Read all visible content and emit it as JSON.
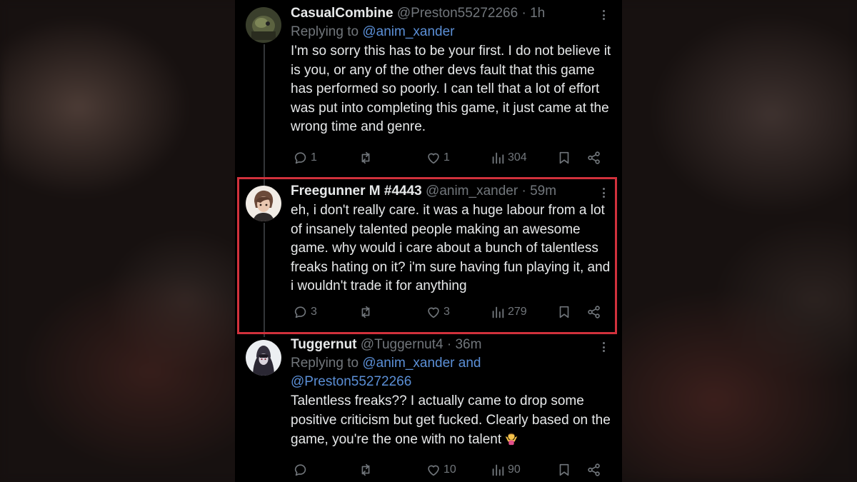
{
  "tweets": [
    {
      "name": "CasualCombine",
      "handle": "@Preston55272266",
      "sep": "·",
      "time": "1h",
      "reply_prefix": "Replying to",
      "reply_mentions": "@anim_xander",
      "reply_mentions_2": "",
      "body": "I'm so sorry this has to be your first. I do not believe it is you, or any of the other devs fault that this game has performed so poorly. I can tell that a lot of effort was put into completing this game, it just came at the wrong time and genre.",
      "replies": "1",
      "retweets": "",
      "likes": "1",
      "views": "304"
    },
    {
      "name": "Freegunner M #4443",
      "handle": "@anim_xander",
      "sep": "·",
      "time": "59m",
      "body": "eh, i don't really care. it was a huge labour from a lot of insanely talented people making an awesome game. why would i care about a bunch of talentless freaks hating on it? i'm sure having fun playing it, and i wouldn't trade it for anything",
      "replies": "3",
      "retweets": "",
      "likes": "3",
      "views": "279"
    },
    {
      "name": "Tuggernut",
      "handle": "@Tuggernut4",
      "sep": "·",
      "time": "36m",
      "reply_prefix": "Replying to",
      "reply_mentions": "@anim_xander and",
      "reply_mentions_2": "@Preston55272266",
      "body": "Talentless freaks?? I actually came to drop some positive criticism but get fucked. Clearly based on the game, you're the one with no talent",
      "replies": "",
      "retweets": "",
      "likes": "10",
      "views": "90"
    }
  ],
  "icons": {
    "reply": "reply-icon",
    "retweet": "retweet-icon",
    "like": "heart-icon",
    "views": "views-icon",
    "bookmark": "bookmark-icon",
    "share": "share-icon",
    "more": "more-icon",
    "emoji": "person-shrugging-emoji"
  },
  "colors": {
    "background": "#000000",
    "text": "#e7e9ea",
    "muted": "#71767b",
    "link": "#5b8fd6",
    "highlight_border": "#d1313c"
  }
}
